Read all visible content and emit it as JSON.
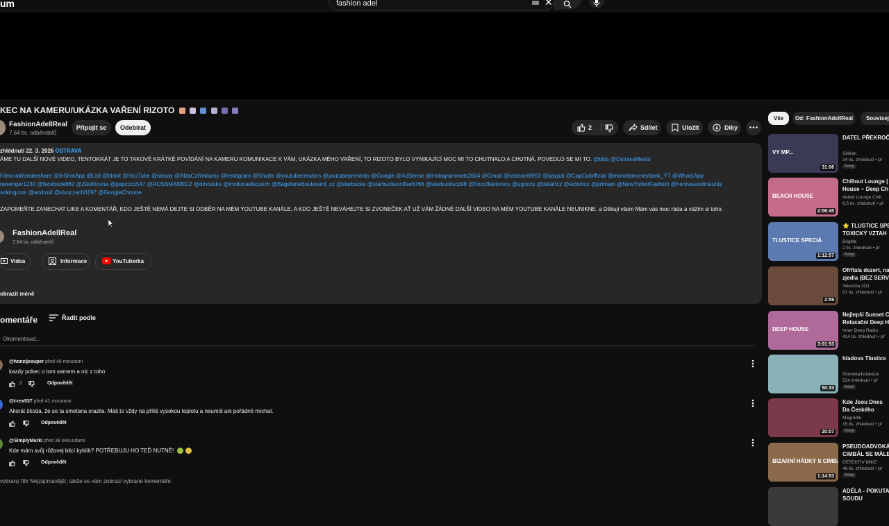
{
  "header": {
    "logo": "um",
    "search_value": "fashion adel"
  },
  "video": {
    "title": "KEC NA KAMERU/UKÁZKA VAŘENÍ RIZOTO",
    "channel_name": "FashionAdellReal",
    "channel_subs": "7,64 tis. odběratelů",
    "join_label": "Připojit se",
    "subscribe_label": "Odebírat",
    "like_count": "2",
    "share_label": "Sdílet",
    "save_label": "Uložit",
    "thanks_label": "Díky"
  },
  "description": {
    "meta_prefix": "zhlédnutí  22. 3. 2026",
    "location": "OSTRAVA",
    "line1": "ÁME TU DALŠÍ NOVÉ VIDEO, TENTOKRÁT JE TO TAKOVÉ KRÁTKÉ POVÍDÁNÍ NA KAMERU KOMUNIKACE K VÁM, UKÁZKA MÉHO VAŘENÍ, TO RIZOTO  BYLO VYNIKAJÍCÍ MOC MI TO CHUTNALO A CHUTNÁ, POVEDLO SE MI TO.",
    "line1_tags": "@billa @OstravaMesto",
    "tags_line1": "FilmoraWondershare @InShotApp @Lidl @tiktok @YouTube @sinsay @AlzaCzReklamy @instagram @Shorts @youtubecreators @youtubepresents @Google @AdSense @instagramreels2604 @Gmail @seznam9993 @paypal @CapCutofficial @monetamoneybank_YT @WhatsApp",
    "tags_line2": "nesenger1230 @facebook862  @Zásilkovna @pepcocz547 @ROSSMANNCZ @dmcesko @mcdonaldsczech @BageterieBoulevard_cz @starbucks @starbuckscoffee6766 @starbucksсz98 @forcoffeelovers @ugoccs @datartcz @actioncz @primark @NewYorkerFashion @hennesandmauritz",
    "tags_line3": "ookingcom @android @vivoczech6197 @GoogleChrome",
    "line3": "ZAPOMEŇTE ZANECHAT LIKE A KOMENTÁŘ, KDO JEŠTĚ NEMÁ DEJTE SI ODBĚR NA MÉM YOUTUBE KANÁLE, A KDO JEŠTĚ NEVÁHEJTE SI ZVONEČEK AŤ UŽ VÁM ŽÁDNÉ DALŠÍ VIDEO NA MÉM YOUTUBE KANÁLE NEUNIKNE. a Děkuji všem Mám vás moc ráda a vážím si toho.",
    "channel_name": "FashionAdellReal",
    "channel_subs": "7,64 tis. odběratelů",
    "btn_videos": "Videa",
    "btn_info": "Informace",
    "btn_youtuberka": "YouTuberka",
    "show_less": "obrazit méně"
  },
  "comments": {
    "heading": "omentáře",
    "sort_label": "Řadit podle",
    "add_placeholder": "Okomentovat...",
    "items": [
      {
        "author": "@honzijesuper",
        "time": "před 48 minutami",
        "text": "kazdy pokec o tom samem a nic z toho",
        "likes": "2",
        "reply": "Odpovědět"
      },
      {
        "author": "@t-rex537",
        "time": "před 41 minutami",
        "text": "Akorát škoda, že se ta smetana srazila. Máš to vždy na příliš vysokou teplotu a neumíš ani pořádně míchat.",
        "likes": "",
        "reply": "Odpovědět"
      },
      {
        "author": "@SimplyMarki",
        "time": "před 38 sekundami",
        "text": "Kde mám svůj růžovej blicí kyblík? POTŘEBUJU HO TEĎ NUTNĚ!",
        "likes": "",
        "reply": "Odpovědět"
      }
    ],
    "filter_note": "vybraný filtr Nejzajímavější, takže se vám zobrazí vybrané komentáře."
  },
  "sidebar": {
    "chips": [
      "Vše",
      "Od: FashionAdellReal",
      "Souvisej"
    ],
    "videos": [
      {
        "title": "DATEL PŘEKROČ",
        "channel": "Sibiřan",
        "views": "34 tis. zhlédnutí • př",
        "badge": "Nový",
        "duration": "31:06",
        "thumb_bg": "#3a3a55",
        "thumb_text": "VY MP..."
      },
      {
        "title": "Chillout Lounge | House ~ Deep Ch",
        "channel": "Velvet Lounge Chill",
        "views": "8,5 tis. zhlédnutí • př",
        "badge": "",
        "duration": "2:06:45",
        "thumb_bg": "#c46a8a",
        "thumb_text": "BEACH HOUSE"
      },
      {
        "title": "⭐ TLUSTICE SPE TOXICKÝ VZTAH",
        "channel": "Brigitte",
        "views": "2 tis. zhlédnutí • př",
        "badge": "Nový",
        "duration": "1:12:57",
        "thumb_bg": "#5a7ab0",
        "thumb_text": "TLUSTICE SPECIÁ"
      },
      {
        "title": "Ofrflala dezert, na zjedla (BEZ SERV",
        "channel": "Televízia JOJ",
        "views": "61 tis. zhlédnutí • př",
        "badge": "",
        "duration": "2:59",
        "thumb_bg": "#6a4a3a",
        "thumb_text": ""
      },
      {
        "title": "Nejlepší Sunset C Relaxační Deep H",
        "channel": "Inner Deep Radio",
        "views": "414 tis. zhlédnutí • př",
        "badge": "",
        "duration": "3:01:53",
        "thumb_bg": "#b06a9a",
        "thumb_text": "DEEP HOUSE"
      },
      {
        "title": "hladova Tlustice",
        "channel": "SimonkaJeJakáJe",
        "views": "524 zhlédnutí • př",
        "badge": "Nový",
        "duration": "50:33",
        "thumb_bg": "#8ab0b8",
        "thumb_text": ""
      },
      {
        "title": "Kde Jsou Dnes Da Českého Internetu",
        "channel": "Magrodik",
        "views": "15 tis. zhlédnutí • př",
        "badge": "Nový",
        "duration": "20:07",
        "thumb_bg": "#7a3a4a",
        "thumb_text": ""
      },
      {
        "title": "PSEUDOADVOKÁ CIMBÁL SE MÁLE",
        "channel": "DETEKTIV MIKE",
        "views": "48 tis. zhlédnutí • př",
        "badge": "Nový",
        "duration": "1:14:53",
        "thumb_bg": "#8a6a4a",
        "thumb_text": "BIZARNÍ HÁDKY S CIMBÁLEM"
      },
      {
        "title": "ADÉLA - POKUTA SOUDU",
        "channel": "",
        "views": "",
        "badge": "",
        "duration": "",
        "thumb_bg": "#3a3a3a",
        "thumb_text": ""
      }
    ]
  },
  "colors": {
    "background": "#0f0f0f",
    "panel": "#272727",
    "link": "#3ea6ff",
    "text": "#f1f1f1",
    "muted": "#aaaaaa"
  }
}
